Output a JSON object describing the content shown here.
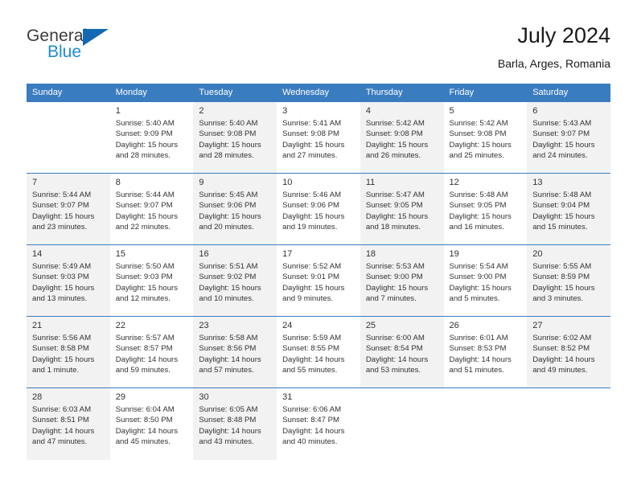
{
  "brand": {
    "line1": "General",
    "line2": "Blue",
    "triangle_color": "#1268b3",
    "line2_color": "#1f8ad2"
  },
  "header": {
    "title": "July 2024",
    "subtitle": "Barla, Arges, Romania"
  },
  "theme": {
    "header_row_bg": "#3a7cc0",
    "header_row_text": "#ffffff",
    "shaded_cell_bg": "#f2f2f2",
    "cell_text": "#333333"
  },
  "weekdays": [
    "Sunday",
    "Monday",
    "Tuesday",
    "Wednesday",
    "Thursday",
    "Friday",
    "Saturday"
  ],
  "weeks": [
    [
      {
        "day": "",
        "sunrise": "",
        "sunset": "",
        "daylight_line1": "",
        "daylight_line2": "",
        "empty": true
      },
      {
        "day": "1",
        "sunrise": "Sunrise: 5:40 AM",
        "sunset": "Sunset: 9:09 PM",
        "daylight_line1": "Daylight: 15 hours",
        "daylight_line2": "and 28 minutes."
      },
      {
        "day": "2",
        "sunrise": "Sunrise: 5:40 AM",
        "sunset": "Sunset: 9:08 PM",
        "daylight_line1": "Daylight: 15 hours",
        "daylight_line2": "and 28 minutes."
      },
      {
        "day": "3",
        "sunrise": "Sunrise: 5:41 AM",
        "sunset": "Sunset: 9:08 PM",
        "daylight_line1": "Daylight: 15 hours",
        "daylight_line2": "and 27 minutes."
      },
      {
        "day": "4",
        "sunrise": "Sunrise: 5:42 AM",
        "sunset": "Sunset: 9:08 PM",
        "daylight_line1": "Daylight: 15 hours",
        "daylight_line2": "and 26 minutes."
      },
      {
        "day": "5",
        "sunrise": "Sunrise: 5:42 AM",
        "sunset": "Sunset: 9:08 PM",
        "daylight_line1": "Daylight: 15 hours",
        "daylight_line2": "and 25 minutes."
      },
      {
        "day": "6",
        "sunrise": "Sunrise: 5:43 AM",
        "sunset": "Sunset: 9:07 PM",
        "daylight_line1": "Daylight: 15 hours",
        "daylight_line2": "and 24 minutes."
      }
    ],
    [
      {
        "day": "7",
        "sunrise": "Sunrise: 5:44 AM",
        "sunset": "Sunset: 9:07 PM",
        "daylight_line1": "Daylight: 15 hours",
        "daylight_line2": "and 23 minutes."
      },
      {
        "day": "8",
        "sunrise": "Sunrise: 5:44 AM",
        "sunset": "Sunset: 9:07 PM",
        "daylight_line1": "Daylight: 15 hours",
        "daylight_line2": "and 22 minutes."
      },
      {
        "day": "9",
        "sunrise": "Sunrise: 5:45 AM",
        "sunset": "Sunset: 9:06 PM",
        "daylight_line1": "Daylight: 15 hours",
        "daylight_line2": "and 20 minutes."
      },
      {
        "day": "10",
        "sunrise": "Sunrise: 5:46 AM",
        "sunset": "Sunset: 9:06 PM",
        "daylight_line1": "Daylight: 15 hours",
        "daylight_line2": "and 19 minutes."
      },
      {
        "day": "11",
        "sunrise": "Sunrise: 5:47 AM",
        "sunset": "Sunset: 9:05 PM",
        "daylight_line1": "Daylight: 15 hours",
        "daylight_line2": "and 18 minutes."
      },
      {
        "day": "12",
        "sunrise": "Sunrise: 5:48 AM",
        "sunset": "Sunset: 9:05 PM",
        "daylight_line1": "Daylight: 15 hours",
        "daylight_line2": "and 16 minutes."
      },
      {
        "day": "13",
        "sunrise": "Sunrise: 5:48 AM",
        "sunset": "Sunset: 9:04 PM",
        "daylight_line1": "Daylight: 15 hours",
        "daylight_line2": "and 15 minutes."
      }
    ],
    [
      {
        "day": "14",
        "sunrise": "Sunrise: 5:49 AM",
        "sunset": "Sunset: 9:03 PM",
        "daylight_line1": "Daylight: 15 hours",
        "daylight_line2": "and 13 minutes."
      },
      {
        "day": "15",
        "sunrise": "Sunrise: 5:50 AM",
        "sunset": "Sunset: 9:03 PM",
        "daylight_line1": "Daylight: 15 hours",
        "daylight_line2": "and 12 minutes."
      },
      {
        "day": "16",
        "sunrise": "Sunrise: 5:51 AM",
        "sunset": "Sunset: 9:02 PM",
        "daylight_line1": "Daylight: 15 hours",
        "daylight_line2": "and 10 minutes."
      },
      {
        "day": "17",
        "sunrise": "Sunrise: 5:52 AM",
        "sunset": "Sunset: 9:01 PM",
        "daylight_line1": "Daylight: 15 hours",
        "daylight_line2": "and 9 minutes."
      },
      {
        "day": "18",
        "sunrise": "Sunrise: 5:53 AM",
        "sunset": "Sunset: 9:00 PM",
        "daylight_line1": "Daylight: 15 hours",
        "daylight_line2": "and 7 minutes."
      },
      {
        "day": "19",
        "sunrise": "Sunrise: 5:54 AM",
        "sunset": "Sunset: 9:00 PM",
        "daylight_line1": "Daylight: 15 hours",
        "daylight_line2": "and 5 minutes."
      },
      {
        "day": "20",
        "sunrise": "Sunrise: 5:55 AM",
        "sunset": "Sunset: 8:59 PM",
        "daylight_line1": "Daylight: 15 hours",
        "daylight_line2": "and 3 minutes."
      }
    ],
    [
      {
        "day": "21",
        "sunrise": "Sunrise: 5:56 AM",
        "sunset": "Sunset: 8:58 PM",
        "daylight_line1": "Daylight: 15 hours",
        "daylight_line2": "and 1 minute."
      },
      {
        "day": "22",
        "sunrise": "Sunrise: 5:57 AM",
        "sunset": "Sunset: 8:57 PM",
        "daylight_line1": "Daylight: 14 hours",
        "daylight_line2": "and 59 minutes."
      },
      {
        "day": "23",
        "sunrise": "Sunrise: 5:58 AM",
        "sunset": "Sunset: 8:56 PM",
        "daylight_line1": "Daylight: 14 hours",
        "daylight_line2": "and 57 minutes."
      },
      {
        "day": "24",
        "sunrise": "Sunrise: 5:59 AM",
        "sunset": "Sunset: 8:55 PM",
        "daylight_line1": "Daylight: 14 hours",
        "daylight_line2": "and 55 minutes."
      },
      {
        "day": "25",
        "sunrise": "Sunrise: 6:00 AM",
        "sunset": "Sunset: 8:54 PM",
        "daylight_line1": "Daylight: 14 hours",
        "daylight_line2": "and 53 minutes."
      },
      {
        "day": "26",
        "sunrise": "Sunrise: 6:01 AM",
        "sunset": "Sunset: 8:53 PM",
        "daylight_line1": "Daylight: 14 hours",
        "daylight_line2": "and 51 minutes."
      },
      {
        "day": "27",
        "sunrise": "Sunrise: 6:02 AM",
        "sunset": "Sunset: 8:52 PM",
        "daylight_line1": "Daylight: 14 hours",
        "daylight_line2": "and 49 minutes."
      }
    ],
    [
      {
        "day": "28",
        "sunrise": "Sunrise: 6:03 AM",
        "sunset": "Sunset: 8:51 PM",
        "daylight_line1": "Daylight: 14 hours",
        "daylight_line2": "and 47 minutes."
      },
      {
        "day": "29",
        "sunrise": "Sunrise: 6:04 AM",
        "sunset": "Sunset: 8:50 PM",
        "daylight_line1": "Daylight: 14 hours",
        "daylight_line2": "and 45 minutes."
      },
      {
        "day": "30",
        "sunrise": "Sunrise: 6:05 AM",
        "sunset": "Sunset: 8:48 PM",
        "daylight_line1": "Daylight: 14 hours",
        "daylight_line2": "and 43 minutes."
      },
      {
        "day": "31",
        "sunrise": "Sunrise: 6:06 AM",
        "sunset": "Sunset: 8:47 PM",
        "daylight_line1": "Daylight: 14 hours",
        "daylight_line2": "and 40 minutes."
      },
      {
        "day": "",
        "sunrise": "",
        "sunset": "",
        "daylight_line1": "",
        "daylight_line2": "",
        "empty": true
      },
      {
        "day": "",
        "sunrise": "",
        "sunset": "",
        "daylight_line1": "",
        "daylight_line2": "",
        "empty": true
      },
      {
        "day": "",
        "sunrise": "",
        "sunset": "",
        "daylight_line1": "",
        "daylight_line2": "",
        "empty": true
      }
    ]
  ]
}
